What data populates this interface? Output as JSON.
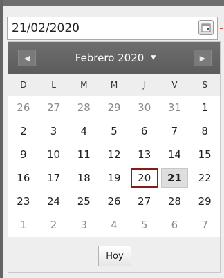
{
  "date_input": {
    "value": "21/02/2020"
  },
  "calendar": {
    "month_title": "Febrero 2020",
    "prev_icon": "chevron-left-icon",
    "next_icon": "chevron-right-icon",
    "weekdays": [
      "D",
      "L",
      "M",
      "M",
      "J",
      "V",
      "S"
    ],
    "weeks": [
      [
        {
          "d": "26",
          "o": true
        },
        {
          "d": "27",
          "o": true
        },
        {
          "d": "28",
          "o": true
        },
        {
          "d": "29",
          "o": true
        },
        {
          "d": "30",
          "o": true
        },
        {
          "d": "31",
          "o": true
        },
        {
          "d": "1"
        }
      ],
      [
        {
          "d": "2"
        },
        {
          "d": "3"
        },
        {
          "d": "4"
        },
        {
          "d": "5"
        },
        {
          "d": "6"
        },
        {
          "d": "7"
        },
        {
          "d": "8"
        }
      ],
      [
        {
          "d": "9"
        },
        {
          "d": "10"
        },
        {
          "d": "11"
        },
        {
          "d": "12"
        },
        {
          "d": "13"
        },
        {
          "d": "14"
        },
        {
          "d": "15"
        }
      ],
      [
        {
          "d": "16"
        },
        {
          "d": "17"
        },
        {
          "d": "18"
        },
        {
          "d": "19"
        },
        {
          "d": "20",
          "today": true
        },
        {
          "d": "21",
          "selected": true
        },
        {
          "d": "22"
        }
      ],
      [
        {
          "d": "23"
        },
        {
          "d": "24"
        },
        {
          "d": "25"
        },
        {
          "d": "26"
        },
        {
          "d": "27"
        },
        {
          "d": "28"
        },
        {
          "d": "29"
        }
      ],
      [
        {
          "d": "1",
          "o": true
        },
        {
          "d": "2",
          "o": true
        },
        {
          "d": "3",
          "o": true
        },
        {
          "d": "4",
          "o": true
        },
        {
          "d": "5",
          "o": true
        },
        {
          "d": "6",
          "o": true
        },
        {
          "d": "7",
          "o": true
        }
      ]
    ],
    "today_button": "Hoy"
  },
  "colors": {
    "header": "#646464",
    "today_border": "#8b1a1a",
    "selected_bg": "#dedede"
  }
}
